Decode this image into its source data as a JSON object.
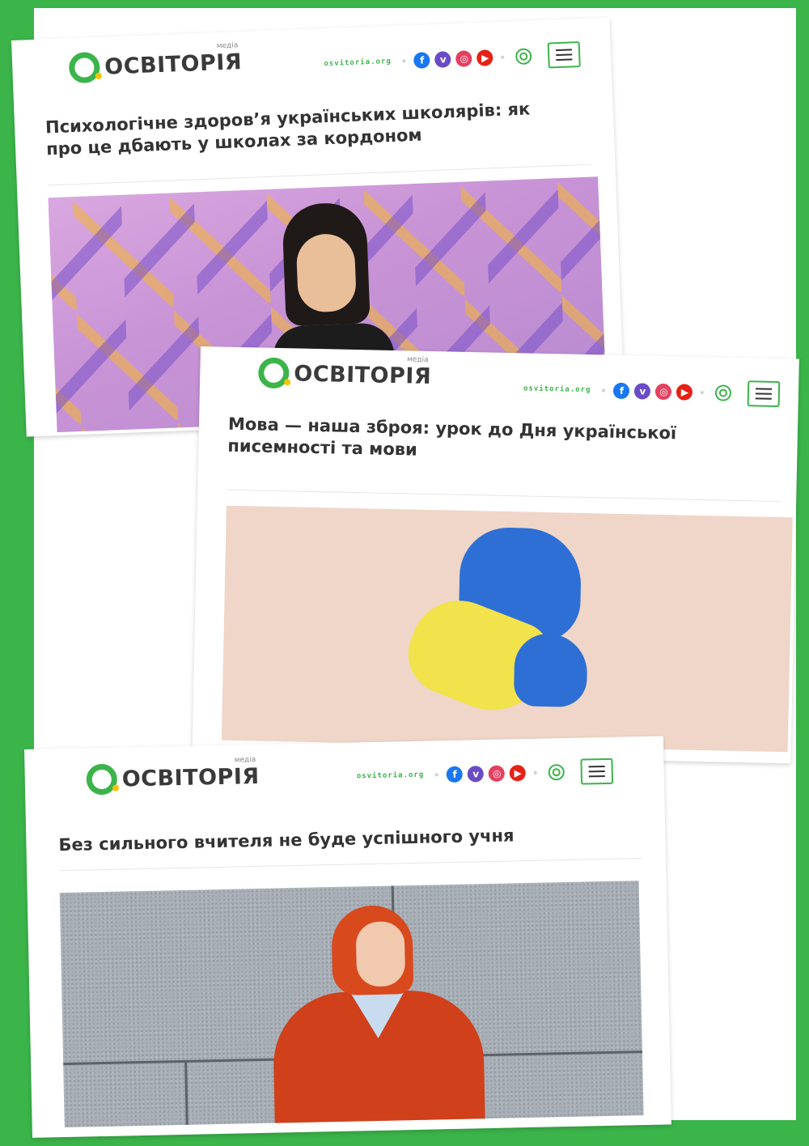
{
  "brand": {
    "logo_text": "ОСВІТОРІЯ",
    "logo_tag": "медіа",
    "site_url": "osvitoria.org",
    "accent_color": "#3bb44a",
    "logo_dot_color": "#f5c400"
  },
  "icons": {
    "facebook": "f",
    "viber": "v",
    "instagram": "◎",
    "youtube": "▶"
  },
  "articles": [
    {
      "headline": "Психологічне здоров’я українських школярів: як про це дбають у школах за кордоном"
    },
    {
      "headline": "Мова — наша зброя: урок до Дня української писемності та мови"
    },
    {
      "headline": "Без сильного вчителя не буде успішного учня"
    }
  ]
}
